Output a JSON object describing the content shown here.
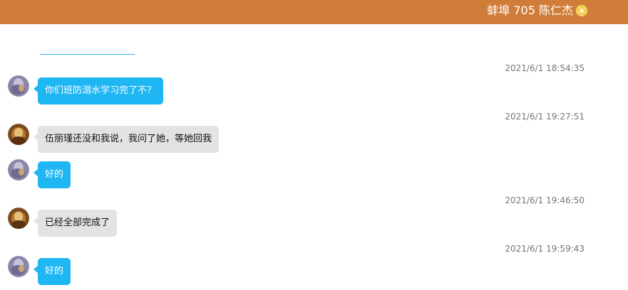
{
  "header": {
    "title": "蚌埠 705 陈仁杰",
    "badge_icon": "star-icon",
    "color": "#d07d3a"
  },
  "messages": [
    {
      "timestamp": "2021/6/1 18:54:35",
      "sender": "teacher",
      "avatar_icon": "teacher-avatar",
      "text": "你们班防溺水学习完了不？",
      "bubble_color": "#1eb6f3"
    },
    {
      "timestamp": "2021/6/1 19:27:51",
      "sender": "student",
      "avatar_icon": "student-avatar",
      "text": "伍丽瑾还没和我说，我问了她，等她回我",
      "bubble_color": "#e3e3e3"
    },
    {
      "timestamp": "",
      "sender": "teacher",
      "avatar_icon": "teacher-avatar",
      "text": "好的",
      "bubble_color": "#1eb6f3"
    },
    {
      "timestamp": "2021/6/1 19:46:50",
      "sender": "student",
      "avatar_icon": "student-avatar",
      "text": "已经全部完成了",
      "bubble_color": "#e3e3e3"
    },
    {
      "timestamp": "2021/6/1 19:59:43",
      "sender": "teacher",
      "avatar_icon": "teacher-avatar",
      "text": "好的",
      "bubble_color": "#1eb6f3"
    }
  ]
}
